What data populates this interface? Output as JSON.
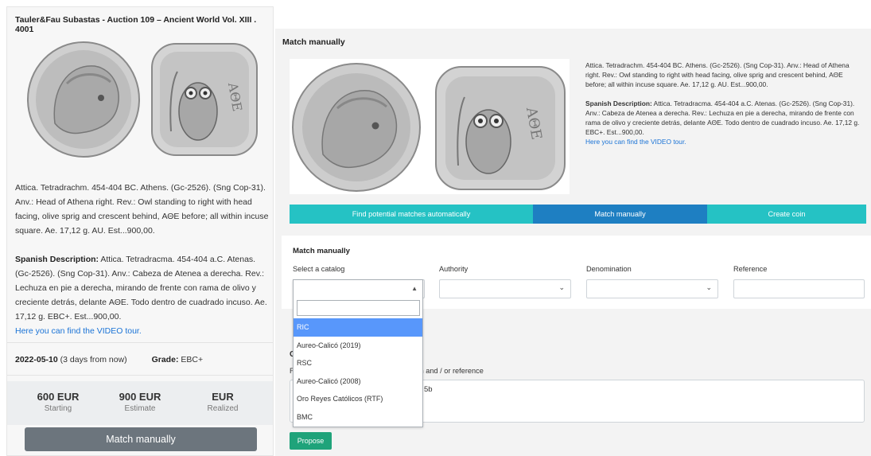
{
  "left": {
    "title": "Tauler&Fau Subastas - Auction 109 – Ancient World Vol. XIII . 4001",
    "description": "Attica. Tetradrachm. 454-404 BC. Athens. (Gc-2526). (Sng Cop-31). Anv.: Head of Athena right. Rev.: Owl standing to right with head facing, olive sprig and crescent behind, ΑΘΕ before; all within incuse square. Ae. 17,12 g. AU. Est...900,00.",
    "spanish_label": "Spanish Description:",
    "spanish_text": " Attica. Tetradracma. 454-404 a.C. Atenas. (Gc-2526). (Sng Cop-31). Anv.: Cabeza de Atenea a derecha. Rev.: Lechuza en pie a derecha, mirando de frente con rama de olivo y creciente detrás, delante ΑΘΕ. Todo dentro de cuadrado incuso. Ae. 17,12 g. EBC+. Est...900,00.",
    "video_link": "Here you can find the VIDEO tour.",
    "date": "2022-05-10",
    "date_note": " (3 days from now)",
    "grade_label": "Grade:",
    "grade_value": " EBC+",
    "prices": [
      {
        "value": "600 EUR",
        "label": "Starting"
      },
      {
        "value": "900 EUR",
        "label": "Estimate"
      },
      {
        "value": "EUR",
        "label": "Realized"
      }
    ],
    "button_label": "Match manually"
  },
  "right": {
    "title": "Match manually",
    "description": "Attica. Tetradrachm. 454-404 BC. Athens. (Gc-2526). (Sng Cop-31). Anv.: Head of Athena right. Rev.: Owl standing to right with head facing, olive sprig and crescent behind, ΑΘΕ before; all within incuse square. Ae. 17,12 g. AU. Est...900,00.",
    "spanish_label": "Spanish Description:",
    "spanish_text": " Attica. Tetradracma. 454-404 a.C. Atenas. (Gc-2526). (Sng Cop-31). Anv.: Cabeza de Atenea a derecha. Rev.: Lechuza en pie a derecha, mirando de frente con rama de olivo y creciente detrás, delante ΑΘΕ. Todo dentro de cuadrado incuso. Ae. 17,12 g. EBC+. Est...900,00.",
    "video_link": "Here you can find the VIDEO tour.",
    "tabs": [
      "Find potential matches automatically",
      "Match manually",
      "Create coin"
    ],
    "active_tab": "Match manually"
  },
  "form": {
    "title": "Match manually",
    "catalog_label": "Select a catalog",
    "authority_label": "Authority",
    "denomination_label": "Denomination",
    "reference_label": "Reference"
  },
  "dropdown": {
    "options": [
      "RIC",
      "Aureo-Calicó (2019)",
      "RSC",
      "Aureo-Calicó (2008)",
      "Oro Reyes Católicos (RTF)",
      "BMC"
    ],
    "highlighted": "RIC"
  },
  "second": {
    "heading_fragment": "C",
    "label_fragment_left": "F",
    "label_fragment_right": "n and / or reference",
    "textarea_fragment": "5b",
    "propose_label": "Propose"
  },
  "colors": {
    "tab_teal": "#25c2c4",
    "tab_active_blue": "#1e7fc2",
    "propose_green": "#1fa37a",
    "match_button_gray": "#6c757d",
    "dropdown_highlight": "#5897fb",
    "link_blue": "#1a73d6"
  }
}
